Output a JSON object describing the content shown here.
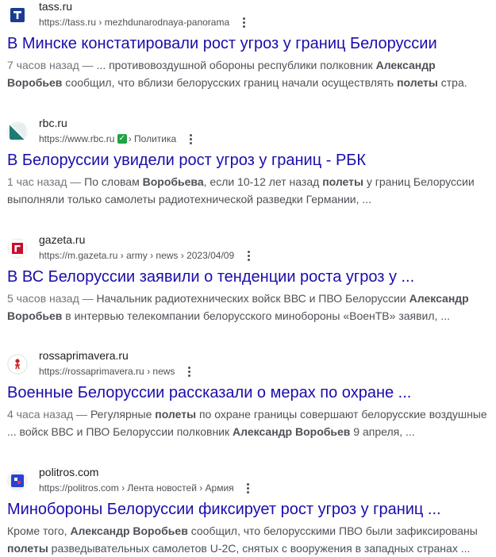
{
  "results": [
    {
      "site_name": "tass.ru",
      "url_base": "https://tass.ru",
      "url_path": "› mezhdunarodnaya-panorama",
      "favicon": "tass-logo-icon",
      "title": "В Минске констатировали рост угроз у границ Белоруссии",
      "date": "7 часов назад —",
      "snippet": [
        {
          "t": " ... противовоздушной обороны республики полковник ",
          "b": false
        },
        {
          "t": "Александр Воробьев",
          "b": true
        },
        {
          "t": " сообщил, что вблизи белорусских границ начали осуществлять ",
          "b": false
        },
        {
          "t": "полеты",
          "b": true
        },
        {
          "t": " стра.",
          "b": false
        }
      ]
    },
    {
      "site_name": "rbc.ru",
      "url_base": "https://www.rbc.ru",
      "url_path": "› Политика",
      "url_badge": "✓",
      "favicon": "rbc-logo-icon",
      "title": "В Белоруссии увидели рост угроз у границ - РБК",
      "date": "1 час назад —",
      "snippet": [
        {
          "t": " По словам ",
          "b": false
        },
        {
          "t": "Воробьева",
          "b": true
        },
        {
          "t": ", если 10-12 лет назад ",
          "b": false
        },
        {
          "t": "полеты",
          "b": true
        },
        {
          "t": " у границ Белоруссии выполняли только самолеты радиотехнической разведки Германии, ...",
          "b": false
        }
      ]
    },
    {
      "site_name": "gazeta.ru",
      "url_base": "https://m.gazeta.ru",
      "url_path": "› army › news › 2023/04/09",
      "favicon": "gazeta-logo-icon",
      "title": "В ВС Белоруссии заявили о тенденции роста угроз у ...",
      "date": "5 часов назад —",
      "snippet": [
        {
          "t": " Начальник радиотехнических войск ВВС и ПВО Белоруссии ",
          "b": false
        },
        {
          "t": "Александр Воробьев",
          "b": true
        },
        {
          "t": " в интервью телекомпании белорусского минобороны «ВоенТВ» заявил, ...",
          "b": false
        }
      ]
    },
    {
      "site_name": "rossaprimavera.ru",
      "url_base": "https://rossaprimavera.ru",
      "url_path": "› news",
      "favicon": "rossaprimavera-logo-icon",
      "title": "Военные Белоруссии рассказали о мерах по охране ...",
      "date": "4 часа назад —",
      "snippet": [
        {
          "t": " Регулярные ",
          "b": false
        },
        {
          "t": "полеты",
          "b": true
        },
        {
          "t": " по охране границы совершают белорусские воздушные ... войск ВВС и ПВО Белоруссии полковник ",
          "b": false
        },
        {
          "t": "Александр Воробьев",
          "b": true
        },
        {
          "t": " 9 апреля, ...",
          "b": false
        }
      ]
    },
    {
      "site_name": "politros.com",
      "url_base": "https://politros.com",
      "url_path": "› Лента новостей › Армия",
      "favicon": "politros-logo-icon",
      "title": "Минобороны Белоруссии фиксирует рост угроз у границ ...",
      "date": "",
      "snippet": [
        {
          "t": "Кроме того, ",
          "b": false
        },
        {
          "t": "Александр Воробьев",
          "b": true
        },
        {
          "t": " сообщил, что белорусскими ПВО были зафиксированы ",
          "b": false
        },
        {
          "t": "полеты",
          "b": true
        },
        {
          "t": " разведывательных самолетов U-2C, снятых с вооружения в западных странах ...",
          "b": false
        }
      ]
    }
  ],
  "colors": {
    "title_link": "#1a0dab",
    "snippet_text": "#4d5156",
    "verified_badge": "#1ea446"
  }
}
